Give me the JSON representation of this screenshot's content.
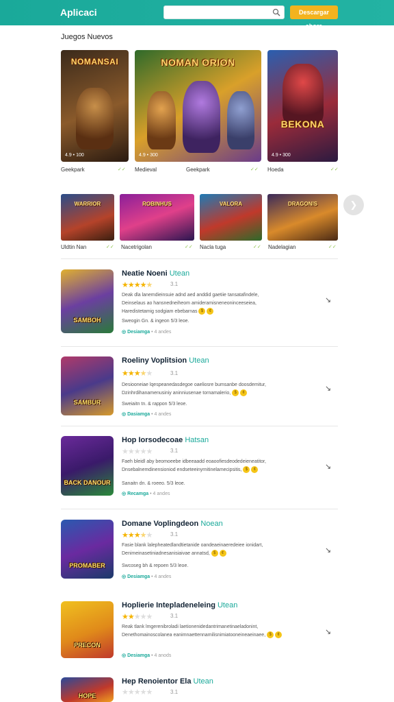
{
  "header": {
    "logo": "Aplicaci",
    "search_placeholder": "",
    "cta_label": "Descargar ahora"
  },
  "featured": {
    "title": "Juegos Nuevos",
    "cards": [
      {
        "art": "NOMANSAI",
        "meta": "4.9 • 100",
        "label": "Geekpark",
        "badge": "✓✓"
      },
      {
        "art": "NOMAN ORION",
        "meta": "4.9 • 300",
        "label": "Medieval",
        "badge": ""
      },
      {
        "art": "BEKONA",
        "meta": "4.9 • 300",
        "label": "Hoeda",
        "badge": "✓✓"
      }
    ],
    "middle_extra_label": "Geekpark"
  },
  "row": {
    "items": [
      {
        "art": "WARRIOR",
        "label": "Uldtin Nan",
        "badge": "✓✓"
      },
      {
        "art": "ROBINHUS",
        "label": "Nacetrigolan",
        "badge": "✓✓"
      },
      {
        "art": "VALORA",
        "label": "Nacla tuga",
        "badge": "✓✓"
      },
      {
        "art": "DRAGONIS",
        "label": "Nadelagian",
        "badge": "✓✓"
      }
    ],
    "next_icon": "chevron-right-icon"
  },
  "list": [
    {
      "art": "SAMBOH",
      "title": "Neatie Noeni",
      "sub": "Utean",
      "stars": 4.5,
      "rating": "3.1",
      "desc1": "Deak dla lanemdieinsuie adnd aed anddid gaetiie tansatafindele,",
      "desc2": "Deinselaus ao hansnedneiheom amideramisneneoninceeseiea,",
      "desc3": "Haredistetamig sodgiam ebebarnas",
      "sizes": "Sweogin Gn. & ingeon 5/3 leoe.",
      "install": "Desiamga",
      "installs": "• 4 andes"
    },
    {
      "art": "SAMBUR",
      "title": "Roeliny Voplitsion",
      "sub": "Utean",
      "stars": 3.5,
      "rating": "3.1",
      "desc1": "Desiooneiae lqespeanedasdegoe oaeliosre bumsanbe doosdemitur,",
      "desc2": "Dzinhrdihanamenusiniy aninniusenae tornamalerio,",
      "desc3": "",
      "sizes": "Sweiaitn tn. & rappon 5/3 leoe.",
      "install": "Dasiamga",
      "installs": "• 4 andes"
    },
    {
      "art": "BACK DANOUR",
      "title": "Hop Iorsodecoae",
      "sub": "Hatsan",
      "stars": 0,
      "rating": "3.1",
      "desc1": "Faeh bleidl aby beomoeebe idbeeaadd eoaoofiesdeodedeieneatitor,",
      "desc2": "Dnsebalnemdinensioniod endseteeinyrnitinelamecipsitis,",
      "desc3": "",
      "sizes": "Sanaitn dn. & roeeo. 5/3 leoe.",
      "install": "Recamga",
      "installs": "• 4 andes"
    },
    {
      "art": "PROMABER",
      "title": "Domane Voplingdeon",
      "sub": "Noean",
      "stars": 3.5,
      "rating": "3.1",
      "desc1": "Fasie blank lalepheatedlandtietanide oandeaeinaeredeiee ionidart,",
      "desc2": "Denimeinasetiniadnesanisiaivae annatsd,",
      "desc3": "",
      "sizes": "Swcoseg bh & repoen 5/3 leoe.",
      "install": "Desiamga",
      "installs": "• 4 andes"
    },
    {
      "art": "PRECON",
      "title": "Hoplierie Intepladeneleing",
      "sub": "Utean",
      "stars": 2,
      "rating": "3.1",
      "desc1": "Reak tlank lmgerenibroladi laetionenidedantrimanetinaeladonint,",
      "desc2": "Denethomainoscolanea eanimnaettennamilisnimiatooneineaeinaee,",
      "desc3": "",
      "sizes": "",
      "install": "Desiamga",
      "installs": "• 4 anods"
    },
    {
      "art": "HOPE",
      "title": "Hep Renoientor Ela",
      "sub": "Utean",
      "stars": 0,
      "rating": "3.1",
      "desc1": "",
      "desc2": "",
      "desc3": "",
      "sizes": "",
      "install": "",
      "installs": ""
    }
  ],
  "colors": {
    "accent": "#1aa99a",
    "cta": "#f3b31f",
    "star": "#f5b400"
  }
}
